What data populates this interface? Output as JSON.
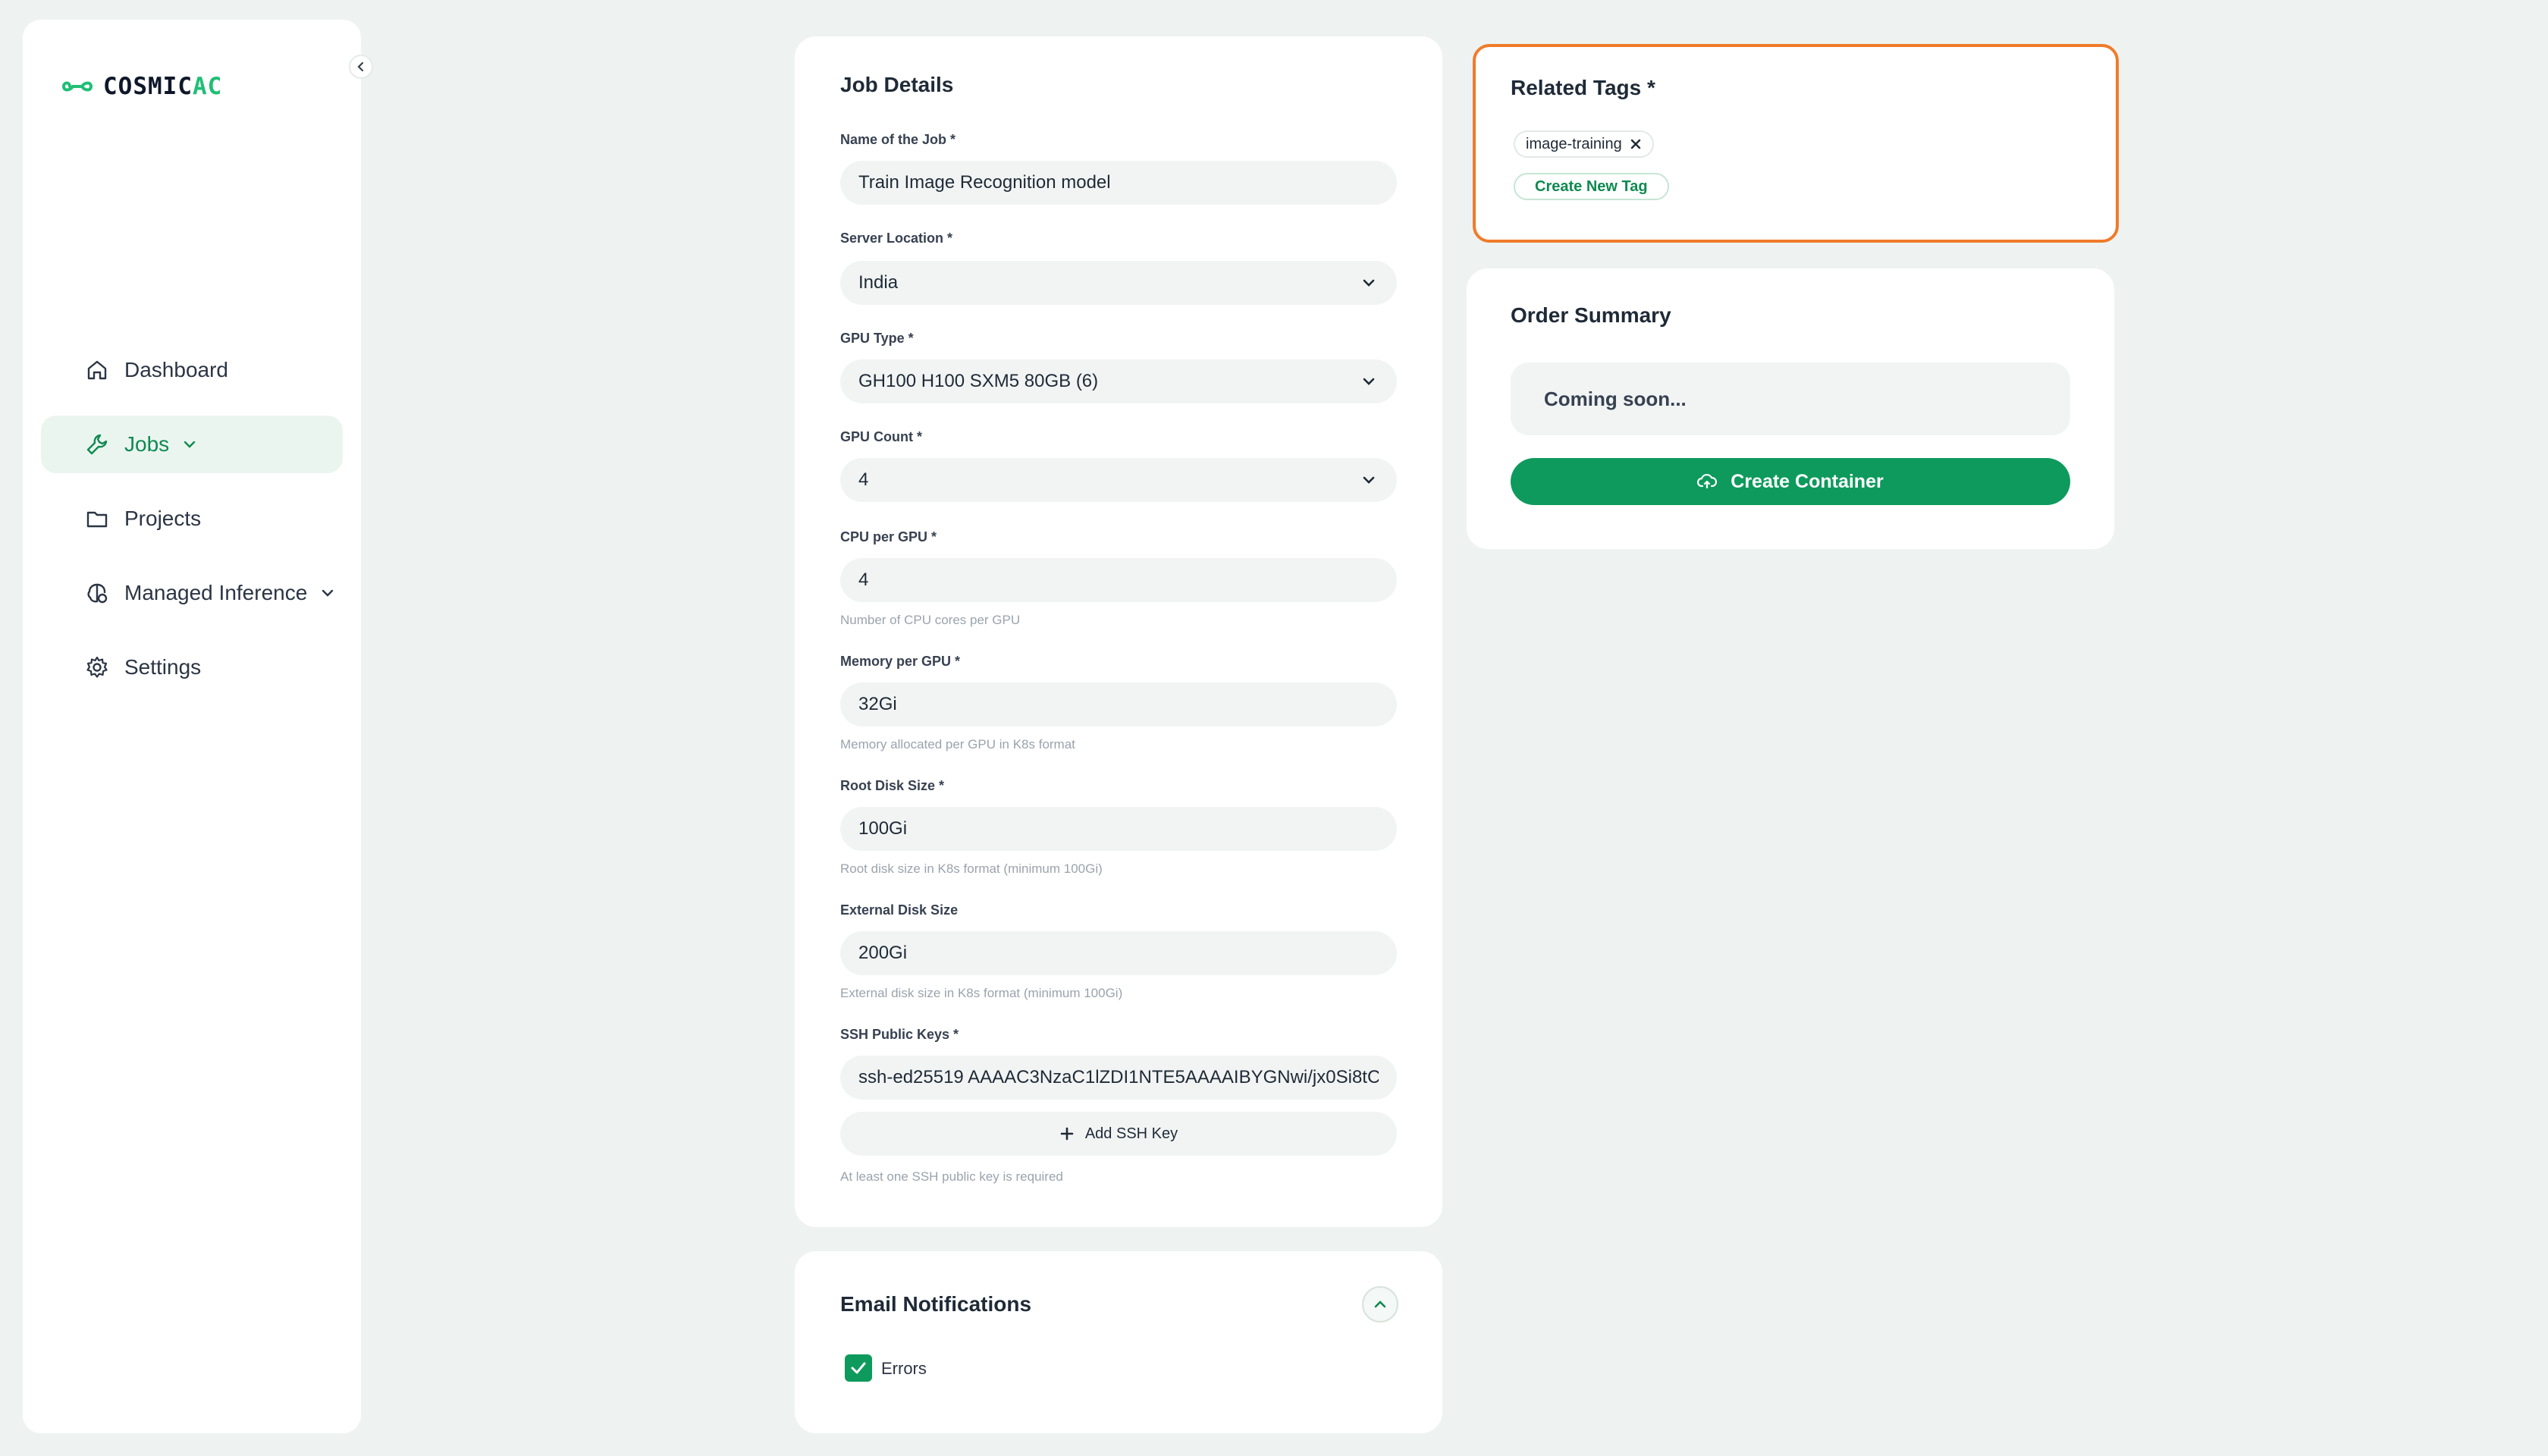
{
  "brand": {
    "name_main": "COSMIC",
    "name_accent": "AC"
  },
  "sidebar": {
    "items": [
      {
        "label": "Dashboard",
        "icon": "home-icon"
      },
      {
        "label": "Jobs",
        "icon": "wrench-icon",
        "active": true,
        "expandable": true
      },
      {
        "label": "Projects",
        "icon": "folder-icon"
      },
      {
        "label": "Managed Inference",
        "icon": "brain-icon",
        "expandable": true
      },
      {
        "label": "Settings",
        "icon": "gear-icon"
      }
    ]
  },
  "job_details": {
    "title": "Job Details",
    "job_name": {
      "label": "Name of the Job *",
      "value": "Train Image Recognition model"
    },
    "server_location": {
      "label": "Server Location *",
      "value": "India"
    },
    "gpu_type": {
      "label": "GPU Type *",
      "value": "GH100 H100 SXM5 80GB (6)"
    },
    "gpu_count": {
      "label": "GPU Count *",
      "value": "4"
    },
    "cpu_per_gpu": {
      "label": "CPU per GPU *",
      "value": "4",
      "hint": "Number of CPU cores per GPU"
    },
    "memory_per_gpu": {
      "label": "Memory per GPU *",
      "value": "32Gi",
      "hint": "Memory allocated per GPU in K8s format"
    },
    "root_disk": {
      "label": "Root Disk Size *",
      "value": "100Gi",
      "hint": "Root disk size in K8s format (minimum 100Gi)"
    },
    "external_disk": {
      "label": "External Disk Size",
      "value": "200Gi",
      "hint": "External disk size in K8s format (minimum 100Gi)"
    },
    "ssh_keys": {
      "label": "SSH Public Keys *",
      "value": "ssh-ed25519 AAAAC3NzaC1lZDI1NTE5AAAAIBYGNwi/jx0Si8tC",
      "add_label": "Add SSH Key",
      "hint": "At least one SSH public key is required"
    }
  },
  "email_notifications": {
    "title": "Email Notifications",
    "options": [
      {
        "label": "Errors",
        "checked": true
      }
    ]
  },
  "related_tags": {
    "title": "Related Tags *",
    "tags": [
      "image-training"
    ],
    "create_label": "Create New Tag"
  },
  "order_summary": {
    "title": "Order Summary",
    "placeholder": "Coming soon...",
    "create_button": "Create Container"
  },
  "colors": {
    "accent": "#0e9a5c",
    "highlight_border": "#f07b2a",
    "background": "#eef3f1"
  }
}
